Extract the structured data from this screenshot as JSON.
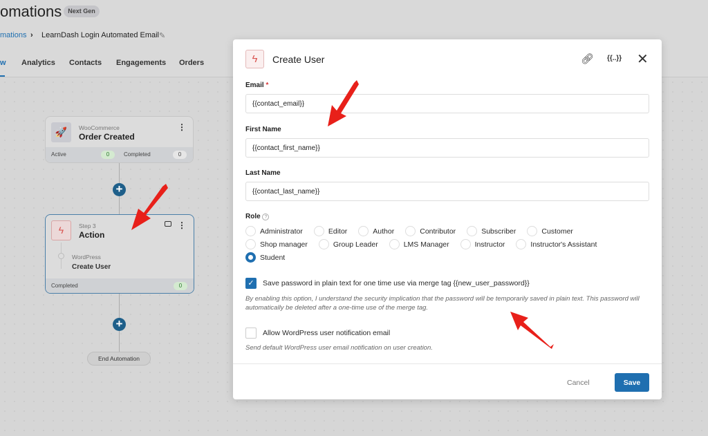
{
  "header": {
    "title": "omations",
    "badge": "Next Gen"
  },
  "breadcrumb": {
    "parent": "mations",
    "current": "LearnDash Login Automated Email"
  },
  "tabs": [
    {
      "label": "w",
      "active": true
    },
    {
      "label": "Analytics"
    },
    {
      "label": "Contacts"
    },
    {
      "label": "Engagements"
    },
    {
      "label": "Orders"
    }
  ],
  "workflow": {
    "trigger": {
      "source": "WooCommerce",
      "title": "Order Created",
      "active_label": "Active",
      "active_count": "0",
      "completed_label": "Completed",
      "completed_count": "0"
    },
    "action": {
      "step": "Step 3",
      "title": "Action",
      "source": "WordPress",
      "name": "Create User",
      "completed_label": "Completed",
      "completed_count": "0"
    },
    "end_label": "End Automation"
  },
  "modal": {
    "title": "Create User",
    "email": {
      "label": "Email",
      "required": "*",
      "value": "{{contact_email}}"
    },
    "first_name": {
      "label": "First Name",
      "value": "{{contact_first_name}}"
    },
    "last_name": {
      "label": "Last Name",
      "value": "{{contact_last_name}}"
    },
    "role": {
      "label": "Role",
      "options": [
        "Administrator",
        "Editor",
        "Author",
        "Contributor",
        "Subscriber",
        "Customer",
        "Shop manager",
        "Group Leader",
        "LMS Manager",
        "Instructor",
        "Instructor's Assistant",
        "Student"
      ],
      "selected": "Student"
    },
    "save_password": {
      "checked": true,
      "label": "Save password in plain text for one time use via merge tag {{new_user_password}}",
      "help": "By enabling this option, I understand the security implication that the password will be temporarily saved in plain text. This password will automatically be deleted after a one-time use of the merge tag."
    },
    "notify": {
      "checked": false,
      "label": "Allow WordPress user notification email",
      "help": "Send default WordPress user email notification on user creation."
    },
    "cancel_label": "Cancel",
    "save_label": "Save"
  },
  "colors": {
    "accent": "#1f6fb0",
    "annotation": "#e8201a",
    "action_icon": "#d9534f"
  }
}
